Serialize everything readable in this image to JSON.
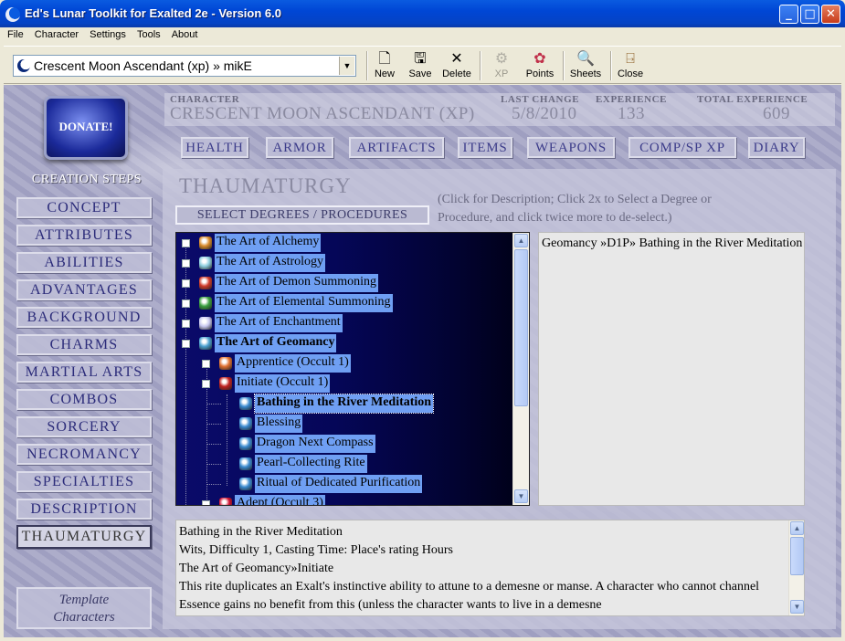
{
  "window": {
    "title": "Ed's Lunar Toolkit for Exalted 2e - Version 6.0"
  },
  "menu": [
    "File",
    "Character",
    "Settings",
    "Tools",
    "About"
  ],
  "toolbar": {
    "character_selected": "Crescent Moon Ascendant (xp) » mikE",
    "buttons": [
      {
        "label": "New",
        "icon": "new-document-icon",
        "enabled": true
      },
      {
        "label": "Save",
        "icon": "save-disk-icon",
        "enabled": true
      },
      {
        "label": "Delete",
        "icon": "delete-x-icon",
        "enabled": true
      },
      {
        "label": "XP",
        "icon": "xp-gear-icon",
        "enabled": false
      },
      {
        "label": "Points",
        "icon": "points-palette-icon",
        "enabled": true
      },
      {
        "label": "Sheets",
        "icon": "sheets-magnifier-icon",
        "enabled": true
      },
      {
        "label": "Close",
        "icon": "close-door-icon",
        "enabled": true
      }
    ]
  },
  "donate_label": "DONATE!",
  "sidebar": {
    "title": "CREATION STEPS",
    "steps": [
      "CONCEPT",
      "ATTRIBUTES",
      "ABILITIES",
      "ADVANTAGES",
      "BACKGROUND",
      "CHARMS",
      "MARTIAL ARTS",
      "COMBOS",
      "SORCERY",
      "NECROMANCY",
      "SPECIALTIES",
      "DESCRIPTION",
      "THAUMATURGY"
    ],
    "active_step": "THAUMATURGY",
    "template_button": [
      "Template",
      "Characters"
    ]
  },
  "header": {
    "character_label": "CHARACTER",
    "character_name": "CRESCENT MOON ASCENDANT (XP)",
    "last_change_label": "LAST CHANGE",
    "last_change": "5/8/2010",
    "experience_label": "EXPERIENCE",
    "experience": "133",
    "total_experience_label": "TOTAL EXPERIENCE",
    "total_experience": "609"
  },
  "tabs": [
    "HEALTH",
    "ARMOR",
    "ARTIFACTS",
    "ITEMS",
    "WEAPONS",
    "COMP/SP XP",
    "DIARY"
  ],
  "panel": {
    "title": "THAUMATURGY",
    "select_button": "SELECT DEGREES / PROCEDURES",
    "hint_line1": "(Click for Description;  Click 2x to Select a Degree or",
    "hint_line2": "Procedure, and click twice more to de-select.)"
  },
  "tree": [
    {
      "label": "The Art of Alchemy",
      "level": 0,
      "icon": "alchemy-gem-icon",
      "expander": true
    },
    {
      "label": "The Art of Astrology",
      "level": 0,
      "icon": "astrology-gem-icon",
      "expander": true
    },
    {
      "label": "The Art of Demon Summoning",
      "level": 0,
      "icon": "demon-gem-icon",
      "expander": true
    },
    {
      "label": "The Art of Elemental Summoning",
      "level": 0,
      "icon": "elemental-gem-icon",
      "expander": true
    },
    {
      "label": "The Art of Enchantment",
      "level": 0,
      "icon": "enchantment-gem-icon",
      "expander": true
    },
    {
      "label": "The Art of Geomancy",
      "level": 0,
      "icon": "geomancy-gem-icon",
      "expander": true,
      "bold": true
    },
    {
      "label": "Apprentice (Occult 1)",
      "level": 1,
      "icon": "apprentice-flame-icon",
      "expander": true
    },
    {
      "label": "Initiate (Occult 1)",
      "level": 1,
      "icon": "initiate-moon-icon",
      "expander": true
    },
    {
      "label": "Bathing in the River Meditation",
      "level": 2,
      "icon": "procedure-gem-icon",
      "selected": true
    },
    {
      "label": "Blessing",
      "level": 2,
      "icon": "procedure-gem-icon"
    },
    {
      "label": "Dragon Next Compass",
      "level": 2,
      "icon": "procedure-gem-icon"
    },
    {
      "label": "Pearl-Collecting Rite",
      "level": 2,
      "icon": "procedure-gem-icon"
    },
    {
      "label": "Ritual of Dedicated Purification",
      "level": 2,
      "icon": "procedure-gem-icon"
    },
    {
      "label": "Adept (Occult 3)",
      "level": 1,
      "icon": "adept-heart-icon",
      "expander": true
    }
  ],
  "selected_list": [
    "Geomancy »D1P» Bathing in the River Meditation"
  ],
  "description": [
    "Bathing in the River Meditation",
    "Wits, Difficulty 1, Casting Time: Place's rating Hours",
    "The Art of Geomancy»Initiate",
    "This rite duplicates an Exalt's instinctive ability to attune to a demesne or manse. A character who cannot channel Essence gains no benefit from this (unless the character wants to live in a demesne"
  ],
  "colors": {
    "titlebar": "#0046d5",
    "stone": "#a6a6c6",
    "tree_bg": "#050658",
    "tree_highlight": "#6f9ff3"
  }
}
